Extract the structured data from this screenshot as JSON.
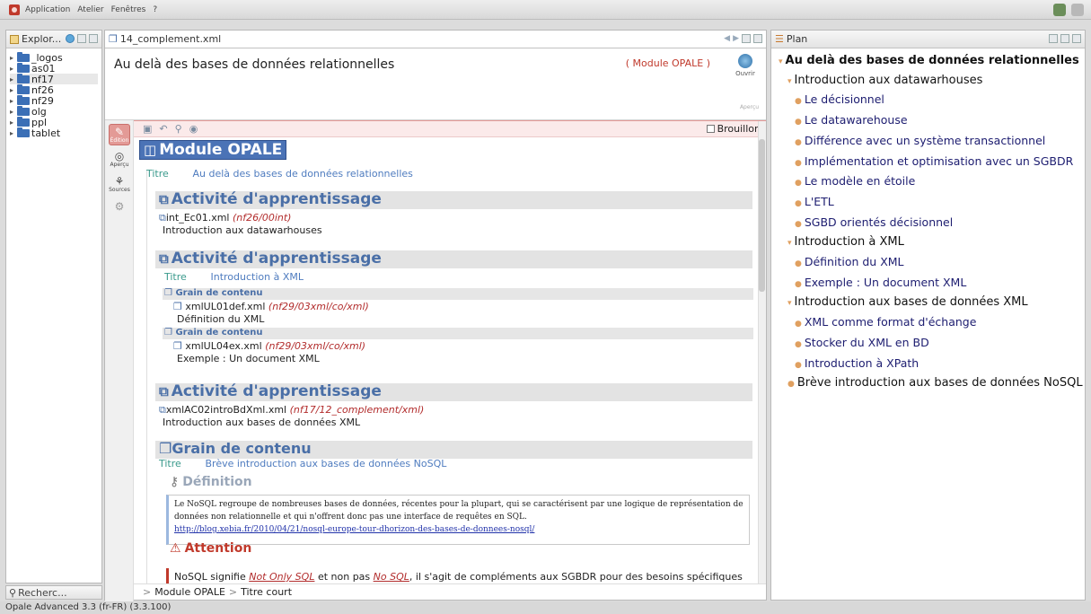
{
  "menubar": {
    "items": [
      "Application",
      "Atelier",
      "Fenêtres",
      "?"
    ]
  },
  "explorer": {
    "tab_label": "Explor...",
    "items": [
      {
        "label": "_logos"
      },
      {
        "label": "as01"
      },
      {
        "label": "nf17"
      },
      {
        "label": "nf26"
      },
      {
        "label": "nf29"
      },
      {
        "label": "olg"
      },
      {
        "label": "ppl"
      },
      {
        "label": "tablet"
      }
    ],
    "search_tab": "Recherc..."
  },
  "editor": {
    "tab_label": "14_complement.xml",
    "doc_title": "Au delà des bases de données relationnelles",
    "doc_type": "( Module OPALE )",
    "open_label": "Ouvrir",
    "sub_label": "Aperçu",
    "modes": [
      "Édition",
      "Aperçu",
      "Sources"
    ],
    "draft_label": "Brouillon",
    "module_label": "Module OPALE",
    "titre_label": "Titre",
    "module_title_value": "Au delà des bases de données relationnelles",
    "activities": [
      {
        "title": "Activité d'apprentissage",
        "file": "int_Ec01.xml",
        "path": "(nf26/00int)",
        "sub": "Introduction aux datawarhouses"
      },
      {
        "title": "Activité d'apprentissage",
        "titre": "Introduction à XML",
        "grains": [
          {
            "title": "Grain de contenu",
            "file": "xmlUL01def.xml",
            "path": "(nf29/03xml/co/xml)",
            "sub": "Définition du XML"
          },
          {
            "title": "Grain de contenu",
            "file": "xmlUL04ex.xml",
            "path": "(nf29/03xml/co/xml)",
            "sub": "Exemple : Un document XML"
          }
        ]
      },
      {
        "title": "Activité d'apprentissage",
        "file": "xmlAC02introBdXml.xml",
        "path": "(nf17/12_complement/xml)",
        "sub": "Introduction aux bases de données XML"
      }
    ],
    "grain": {
      "title": "Grain de contenu",
      "titre": "Brève introduction aux bases de données NoSQL",
      "definition_title": "Définition",
      "definition_text": "Le NoSQL regroupe de nombreuses bases de données, récentes pour la plupart, qui se caractérisent par une logique de représentation de données non relationnelle et qui n'offrent donc pas une interface de requêtes en SQL.",
      "definition_link": "http://blog.xebia.fr/2010/04/21/nosql-europe-tour-dhorizon-des-bases-de-donnees-nosql/",
      "attention_title": "Attention",
      "attention_text_a": "NoSQL signifie ",
      "attention_em1": "Not Only SQL",
      "attention_text_b": " et non pas ",
      "attention_em2": "No SQL",
      "attention_text_c": ", il s'agit de compléments aux SGBDR pour des besoins spécifiques et non de solutions de remplacement."
    },
    "breadcrumb": [
      "Module OPALE",
      "Titre court"
    ]
  },
  "plan": {
    "tab_label": "Plan",
    "items": [
      {
        "level": 0,
        "label": "Au delà des bases de données relationnelles"
      },
      {
        "level": 1,
        "label": "Introduction aux datawarhouses"
      },
      {
        "level": 2,
        "label": "Le décisionnel"
      },
      {
        "level": 2,
        "label": "Le datawarehouse"
      },
      {
        "level": 2,
        "label": "Différence avec un système transactionnel"
      },
      {
        "level": 2,
        "label": "Implémentation et optimisation avec un SGBDR"
      },
      {
        "level": 2,
        "label": "Le modèle en étoile"
      },
      {
        "level": 2,
        "label": "L'ETL"
      },
      {
        "level": 2,
        "label": "SGBD orientés décisionnel"
      },
      {
        "level": 1,
        "label": "Introduction à XML"
      },
      {
        "level": 2,
        "label": "Définition du XML"
      },
      {
        "level": 2,
        "label": "Exemple : Un document XML"
      },
      {
        "level": 1,
        "label": "Introduction aux bases de données XML"
      },
      {
        "level": 2,
        "label": "XML comme format d'échange"
      },
      {
        "level": 2,
        "label": "Stocker du XML en BD"
      },
      {
        "level": 2,
        "label": "Introduction à XPath"
      },
      {
        "level": 1,
        "label": "Brève introduction aux bases de données NoSQL"
      }
    ]
  },
  "status": {
    "text": "Opale Advanced 3.3 (fr-FR) (3.3.100)"
  },
  "colors": {
    "accent_blue": "#4b73b6",
    "path_red": "#b22c2c",
    "attention_red": "#c0392b"
  }
}
